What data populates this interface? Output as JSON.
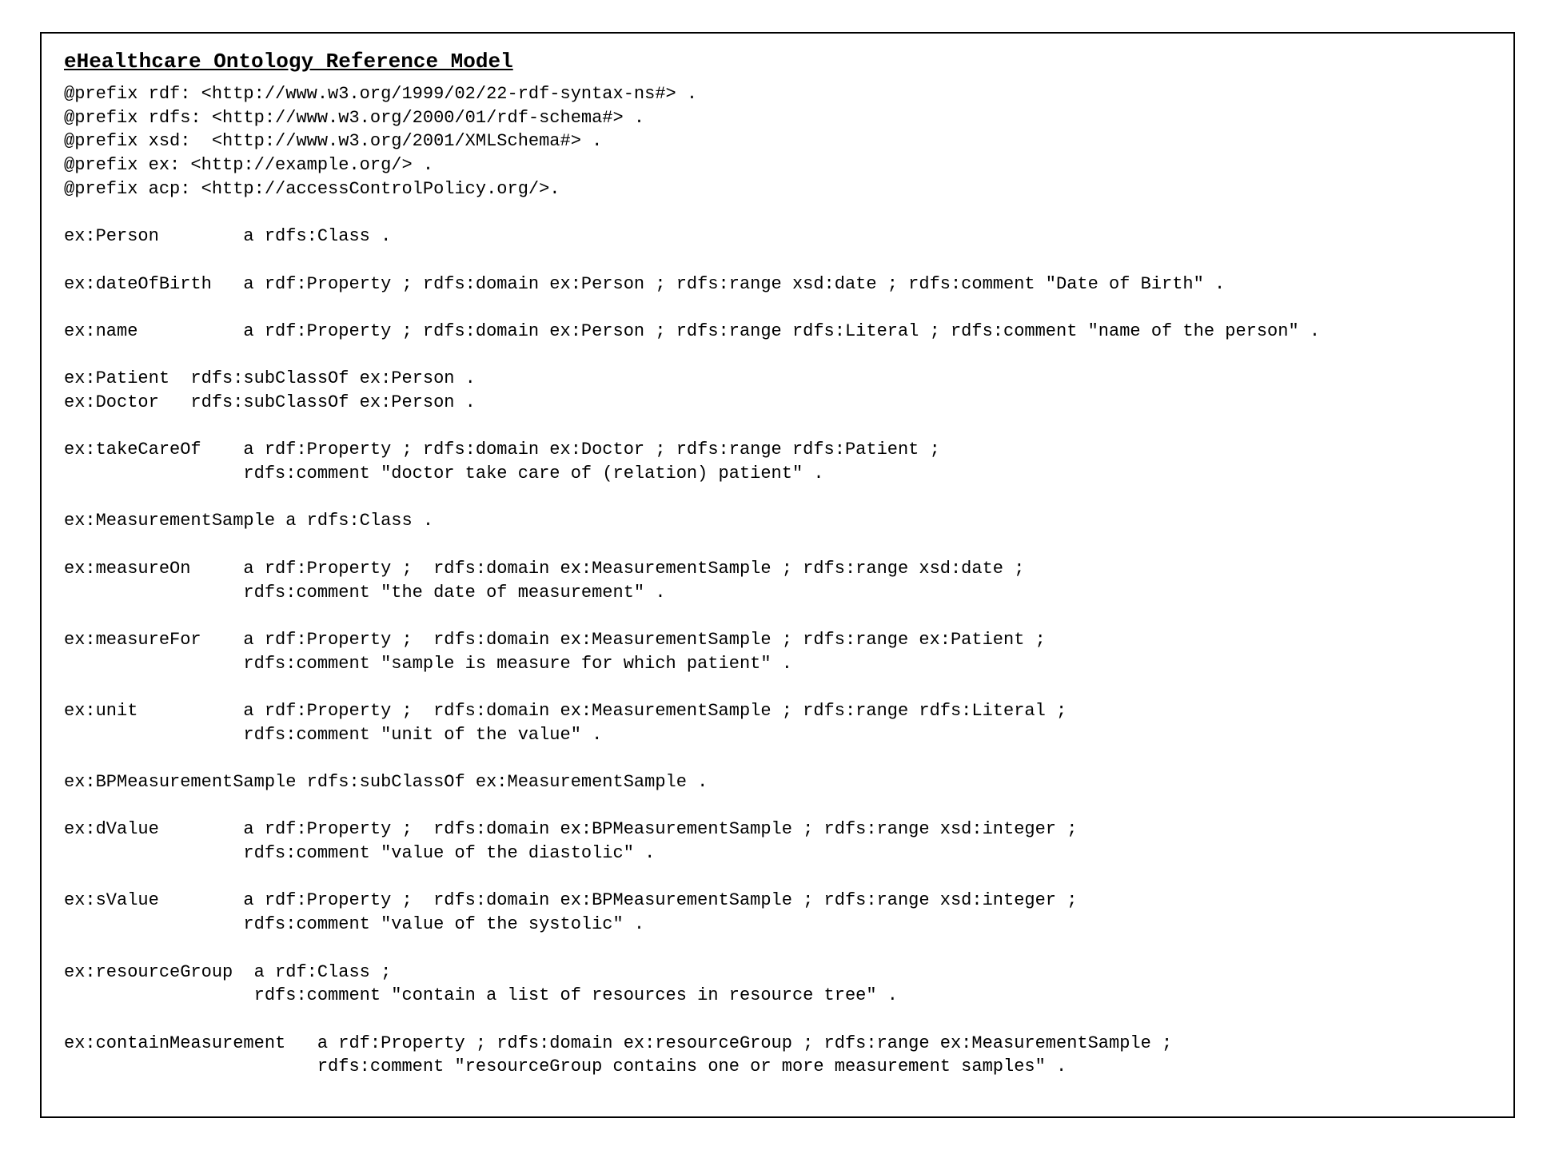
{
  "title": "eHealthcare Ontology Reference Model",
  "code": "@prefix rdf: <http://www.w3.org/1999/02/22-rdf-syntax-ns#> .\n@prefix rdfs: <http://www.w3.org/2000/01/rdf-schema#> .\n@prefix xsd:  <http://www.w3.org/2001/XMLSchema#> .\n@prefix ex: <http://example.org/> .\n@prefix acp: <http://accessControlPolicy.org/>.\n\nex:Person        a rdfs:Class .\n\nex:dateOfBirth   a rdf:Property ; rdfs:domain ex:Person ; rdfs:range xsd:date ; rdfs:comment \"Date of Birth\" .\n\nex:name          a rdf:Property ; rdfs:domain ex:Person ; rdfs:range rdfs:Literal ; rdfs:comment \"name of the person\" .\n\nex:Patient  rdfs:subClassOf ex:Person .\nex:Doctor   rdfs:subClassOf ex:Person .\n\nex:takeCareOf    a rdf:Property ; rdfs:domain ex:Doctor ; rdfs:range rdfs:Patient ;\n                 rdfs:comment \"doctor take care of (relation) patient\" .\n\nex:MeasurementSample a rdfs:Class .\n\nex:measureOn     a rdf:Property ;  rdfs:domain ex:MeasurementSample ; rdfs:range xsd:date ;\n                 rdfs:comment \"the date of measurement\" .\n\nex:measureFor    a rdf:Property ;  rdfs:domain ex:MeasurementSample ; rdfs:range ex:Patient ;\n                 rdfs:comment \"sample is measure for which patient\" .\n\nex:unit          a rdf:Property ;  rdfs:domain ex:MeasurementSample ; rdfs:range rdfs:Literal ;\n                 rdfs:comment \"unit of the value\" .\n\nex:BPMeasurementSample rdfs:subClassOf ex:MeasurementSample .\n\nex:dValue        a rdf:Property ;  rdfs:domain ex:BPMeasurementSample ; rdfs:range xsd:integer ;\n                 rdfs:comment \"value of the diastolic\" .\n\nex:sValue        a rdf:Property ;  rdfs:domain ex:BPMeasurementSample ; rdfs:range xsd:integer ;\n                 rdfs:comment \"value of the systolic\" .\n\nex:resourceGroup  a rdf:Class ;\n                  rdfs:comment \"contain a list of resources in resource tree\" .\n\nex:containMeasurement   a rdf:Property ; rdfs:domain ex:resourceGroup ; rdfs:range ex:MeasurementSample ;\n                        rdfs:comment \"resourceGroup contains one or more measurement samples\" ."
}
